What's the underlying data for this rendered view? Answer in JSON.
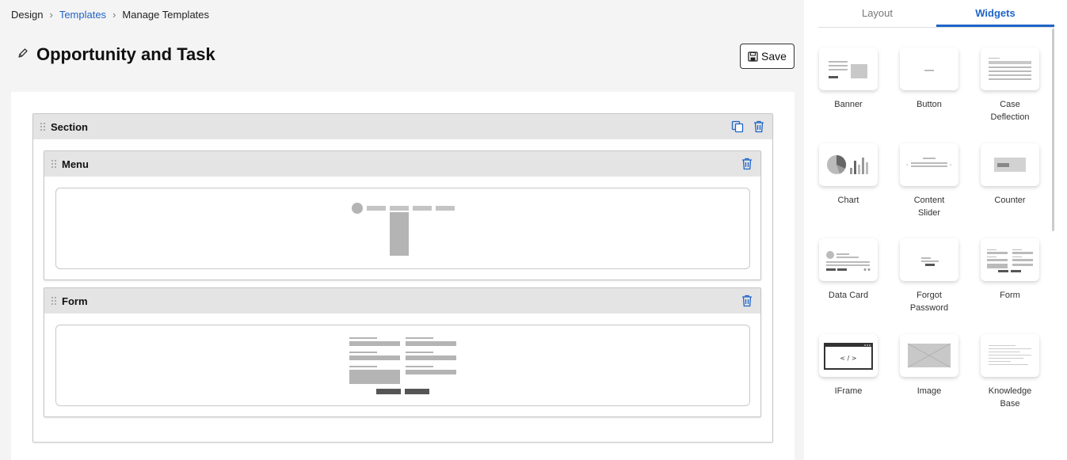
{
  "breadcrumb": {
    "items": [
      "Design",
      "Templates",
      "Manage Templates"
    ]
  },
  "page": {
    "title": "Opportunity and Task",
    "save_label": "Save"
  },
  "canvas": {
    "section_label": "Section",
    "menu_label": "Menu",
    "form_label": "Form"
  },
  "panel": {
    "tabs": [
      "Layout",
      "Widgets"
    ],
    "active_tab": "Widgets",
    "widgets": [
      {
        "name": "Banner",
        "icon": "banner-icon"
      },
      {
        "name": "Button",
        "icon": "button-icon"
      },
      {
        "name": "Case Deflection",
        "icon": "case-deflection-icon"
      },
      {
        "name": "Chart",
        "icon": "chart-icon"
      },
      {
        "name": "Content Slider",
        "icon": "content-slider-icon"
      },
      {
        "name": "Counter",
        "icon": "counter-icon"
      },
      {
        "name": "Data Card",
        "icon": "data-card-icon"
      },
      {
        "name": "Forgot Password",
        "icon": "forgot-password-icon"
      },
      {
        "name": "Form",
        "icon": "form-icon"
      },
      {
        "name": "IFrame",
        "icon": "iframe-icon"
      },
      {
        "name": "Image",
        "icon": "image-icon"
      },
      {
        "name": "Knowledge Base",
        "icon": "knowledge-base-icon"
      }
    ]
  },
  "colors": {
    "accent": "#1f64c8",
    "bar": "#e4e4e4",
    "placeholder": "#b4b4b4",
    "dark_placeholder": "#555555"
  }
}
